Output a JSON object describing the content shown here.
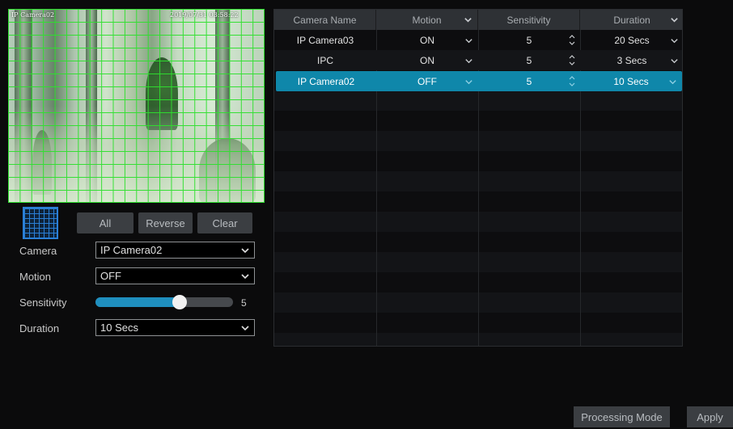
{
  "preview": {
    "osd_camera": "IP Camera02",
    "osd_datetime": "2019/07/31 03:58:22"
  },
  "area_buttons": {
    "all": "All",
    "reverse": "Reverse",
    "clear": "Clear"
  },
  "form": {
    "camera_label": "Camera",
    "camera_value": "IP Camera02",
    "motion_label": "Motion",
    "motion_value": "OFF",
    "sensitivity_label": "Sensitivity",
    "sensitivity_value": "5",
    "sensitivity_level": 5,
    "sensitivity_max": 8,
    "duration_label": "Duration",
    "duration_value": "10 Secs"
  },
  "table": {
    "headers": {
      "camera_name": "Camera Name",
      "motion": "Motion",
      "sensitivity": "Sensitivity",
      "duration": "Duration"
    },
    "rows": [
      {
        "camera_name": "IP Camera03",
        "motion": "ON",
        "sensitivity": "5",
        "duration": "20 Secs"
      },
      {
        "camera_name": "IPC",
        "motion": "ON",
        "sensitivity": "5",
        "duration": "3 Secs"
      },
      {
        "camera_name": "IP Camera02",
        "motion": "OFF",
        "sensitivity": "5",
        "duration": "10 Secs"
      }
    ],
    "selected_row": 2
  },
  "footer": {
    "processing_mode": "Processing Mode",
    "apply": "Apply"
  },
  "colors": {
    "accent": "#0f87aa",
    "grid": "#2ee02e",
    "slider": "#1f8fbf"
  }
}
